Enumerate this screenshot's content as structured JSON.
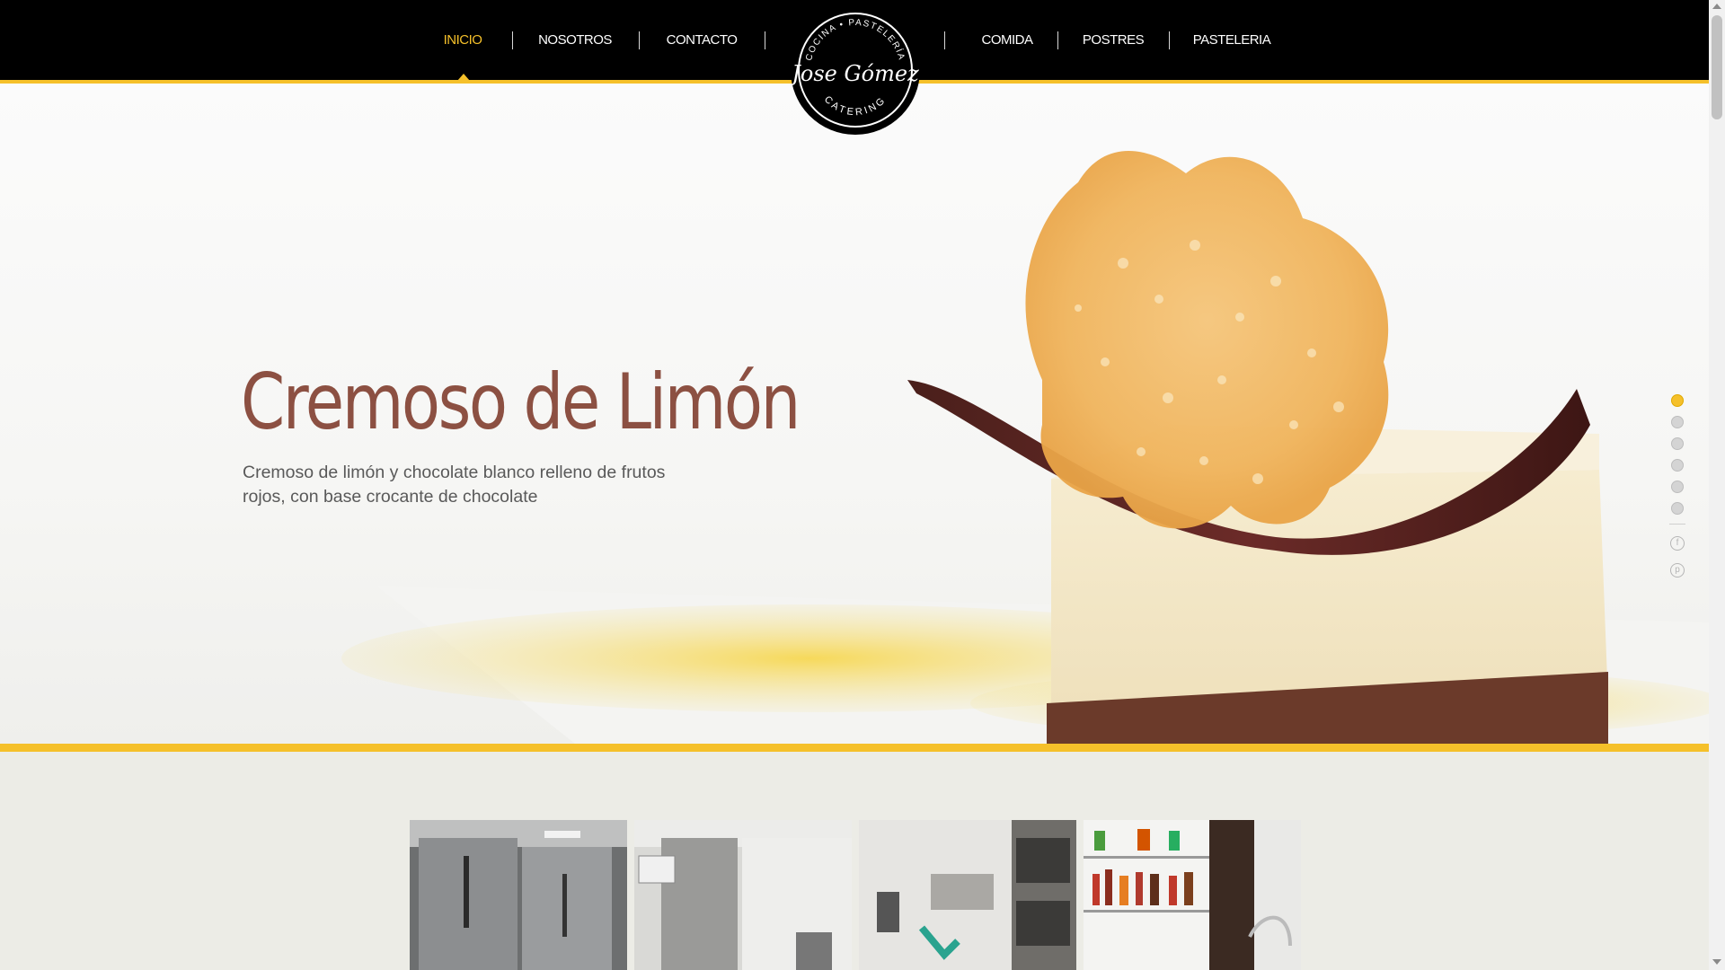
{
  "nav": {
    "items_left": [
      {
        "label": "INICIO",
        "active": true
      },
      {
        "label": "NOSOTROS",
        "active": false
      },
      {
        "label": "CONTACTO",
        "active": false
      }
    ],
    "items_right": [
      {
        "label": "COMIDA",
        "active": false
      },
      {
        "label": "POSTRES",
        "active": false
      },
      {
        "label": "PASTELERIA",
        "active": false
      }
    ],
    "logo": {
      "top_arc": "COCINA • PASTELERÍA",
      "name": "Jose Gómez",
      "bottom_arc": "CATERING"
    }
  },
  "hero": {
    "title": "Cremoso de Limón",
    "description": "Cremoso de limón y chocolate blanco relleno de frutos rojos, con base crocante de chocolate"
  },
  "slider": {
    "slide_count": 6,
    "active_index": 0
  },
  "social": [
    {
      "icon": "facebook-icon",
      "glyph": "f"
    },
    {
      "icon": "pinterest-icon",
      "glyph": "p"
    }
  ],
  "gallery": [
    {
      "subject": "kitchen-refrigerator"
    },
    {
      "subject": "kitchen-shelving"
    },
    {
      "subject": "kitchen-ovens"
    },
    {
      "subject": "kitchen-pantry"
    }
  ],
  "colors": {
    "accent": "#f5c02a",
    "nav_bg": "#000000",
    "title": "#8c5042",
    "text": "#595959"
  }
}
